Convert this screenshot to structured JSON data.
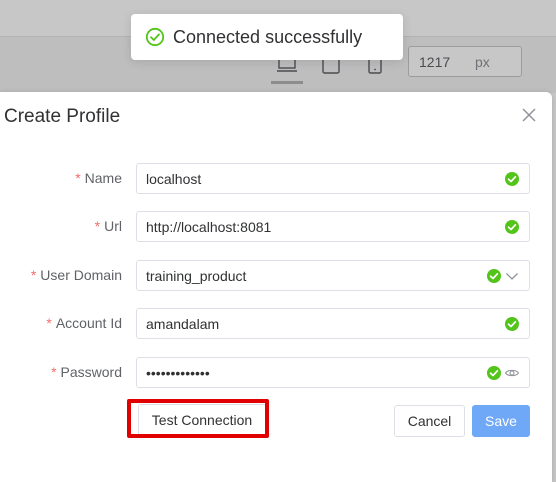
{
  "colors": {
    "success": "#52c41a",
    "required": "#f56c6c",
    "primary": "#6fa8f7",
    "highlight": "#e00000"
  },
  "toast": {
    "icon": "check-circle-icon",
    "message": "Connected successfully"
  },
  "toolbar": {
    "device_buttons": [
      "desktop-icon",
      "tablet-icon",
      "mobile-icon"
    ],
    "width_value": "1217",
    "width_unit": "px"
  },
  "dialog": {
    "title": "Create Profile",
    "close_icon": "close-icon",
    "fields": {
      "name": {
        "required": "*",
        "label": "Name",
        "value": "localhost"
      },
      "url": {
        "required": "*",
        "label": "Url",
        "value": "http://localhost:8081"
      },
      "user_domain": {
        "required": "*",
        "label": "User Domain",
        "value": "training_product"
      },
      "account_id": {
        "required": "*",
        "label": "Account Id",
        "value": "amandalam"
      },
      "password": {
        "required": "*",
        "label": "Password",
        "value": "•••••••••••••"
      }
    },
    "buttons": {
      "test_connection": "Test Connection",
      "cancel": "Cancel",
      "save": "Save"
    }
  }
}
